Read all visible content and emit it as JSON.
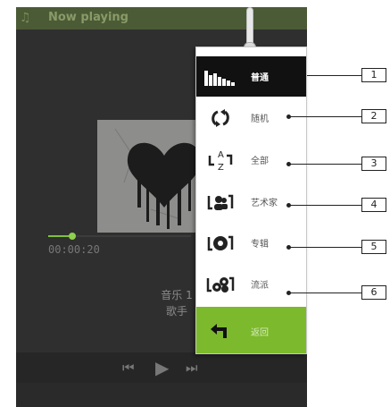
{
  "topbar": {
    "title": "Now playing",
    "icon": "music-note-icon"
  },
  "player": {
    "elapsed": "00:00:20",
    "progress": 0.17,
    "song": "音乐 1",
    "artist": "歌手",
    "controls": [
      "previous-icon",
      "play-icon",
      "next-icon"
    ]
  },
  "menu": {
    "items": [
      {
        "label": "普通",
        "icon": "equalizer-icon",
        "selected": true,
        "callout": "1"
      },
      {
        "label": "随机",
        "icon": "shuffle-icon",
        "selected": false,
        "callout": "2"
      },
      {
        "label": "全部",
        "icon": "sort-az-icon",
        "selected": false,
        "callout": "3"
      },
      {
        "label": "艺术家",
        "icon": "artist-icon",
        "selected": false,
        "callout": "4"
      },
      {
        "label": "专辑",
        "icon": "album-icon",
        "selected": false,
        "callout": "5"
      },
      {
        "label": "流派",
        "icon": "genre-icon",
        "selected": false,
        "callout": "6"
      }
    ],
    "back": {
      "label": "返回",
      "icon": "back-arrow-icon"
    }
  },
  "colors": {
    "accent": "#7cb92d",
    "topbar": "#4b5b36",
    "selected": "#111111"
  }
}
